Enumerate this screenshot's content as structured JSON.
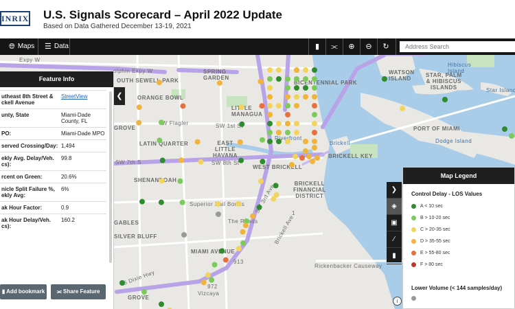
{
  "header": {
    "logo": "INRIX",
    "title": "U.S. Signals Scorecard – April 2022 Update",
    "subtitle": "Based on Data Gathered December 13-19, 2021"
  },
  "toolbar": {
    "maps_label": "Maps",
    "data_label": "Data",
    "search_placeholder": "Address Search"
  },
  "map_labels": {
    "expy_w": "Expy W",
    "dolphin_expy": "olphin Expy W",
    "south_sewell_park": "OUTH SEWELL PARK",
    "spring_garden": "SPRING\nGARDEN",
    "bicentennial_park": "BICENTENNIAL PARK",
    "watson_island": "WATSON\nISLAND",
    "hibiscus_island": "Hibiscus\nIsland",
    "star_palm": "STAR, PALM\n& HIBISCUS\nISLANDS",
    "star_island": "Star Island",
    "orange_bowl": "ORANGE BOWL",
    "little_managua": "LITTLE\nMANAGUA",
    "grove": "GROVE",
    "w_flagler": "W Flagler",
    "sw_1st": "SW 1st St",
    "port_of_miami": "PORT OF MIAMI",
    "dodge_island": "Dodge Island",
    "latin_quarter": "LATIN QUARTER",
    "east_little_havana": "EAST\nLITTLE\nHAVANA",
    "riverfront": "Riverfront",
    "brickell": "Brickell",
    "brickell_key": "BRICKELL KEY",
    "sw_7th": "SW 7th S",
    "sw_8th": "SW 8th St",
    "west_brickell": "WEST BRICKELL",
    "shenandoah": "SHENANDOAH",
    "brickell_financial": "BRICKELL\nFINANCIAL\nDISTRICT",
    "superior_bail_bonds": "Superior Bail Bonds",
    "sw_3rd_ave": "SW 3rd Ave",
    "the_roads": "The Roads",
    "brickell_ave": "Brickell Ave",
    "gables": "GABLES",
    "silver_bluff": "SILVER BLUFF",
    "miami_avenue": "MIAMI AVENUE",
    "rickenbacker": "Rickenbacker Causeway",
    "grove_south": "GROVE",
    "vizcaya": "Vizcaya",
    "s_dixie": "S Dixie Hwy",
    "route_913": "913",
    "route_1": "1",
    "route_972": "972"
  },
  "feature_info": {
    "title": "Feature Info",
    "rows": [
      {
        "key": "utheast 8th Street & ckell Avenue",
        "value": "StreetView",
        "link": true
      },
      {
        "key": "unty, State",
        "value": "Miami-Dade County, FL"
      },
      {
        "key": "PO:",
        "value": "Miami-Dade MPO"
      },
      {
        "key": "served Crossing/Day:",
        "value": "1,494"
      },
      {
        "key": "ekly Avg. Delay/Veh. cs):",
        "value": "99.8"
      },
      {
        "key": "rcent on Green:",
        "value": "20.6%"
      },
      {
        "key": "nicle Split Failure %, ekly Avg:",
        "value": "6%"
      },
      {
        "key": "ak Hour Factor:",
        "value": "0.9"
      },
      {
        "key": "ak Hour Delay/Veh. cs):",
        "value": "160.2"
      }
    ],
    "add_bookmark": "Add bookmark",
    "share_feature": "Share Feature"
  },
  "legend": {
    "title": "Map Legend",
    "subtitle": "Control Delay - LOS Values",
    "items": [
      {
        "label": "A < 10 sec",
        "color": "#2e8b2e"
      },
      {
        "label": "B > 10-20 sec",
        "color": "#7ccb5a"
      },
      {
        "label": "C > 20-35 sec",
        "color": "#f2d45c"
      },
      {
        "label": "D > 35-55 sec",
        "color": "#f0b43a"
      },
      {
        "label": "E > 55-80 sec",
        "color": "#e8703a"
      },
      {
        "label": "F > 80 sec",
        "color": "#c0392b"
      }
    ],
    "low_volume": "Lower Volume (< 144 samples/day)",
    "low_volume_color": "#9a9a9a"
  },
  "colors": {
    "toolbar": "#151515",
    "water": "#a9cde8",
    "road_highlight": "#b9a3e8",
    "land": "#e9e8e4"
  }
}
